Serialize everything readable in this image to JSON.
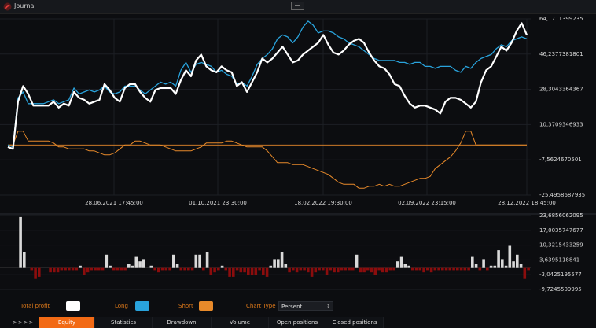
{
  "window": {
    "title": "Journal"
  },
  "colors": {
    "total_profit": "#ffffff",
    "long": "#29a3dc",
    "short": "#e88a2a",
    "bar_positive": "#d9d9d9",
    "bar_negative": "#8b0d0d",
    "accent": "#f26a15"
  },
  "upper_chart": {
    "y_ticks": [
      "64,1711399235",
      "46,2377381801",
      "28,3043364367",
      "10,3709346933",
      "-7,5624670501",
      "-25,4958687935"
    ],
    "x_ticks": [
      "28.06.2021 17:45:00",
      "01.10.2021 23:30:00",
      "18.02.2022 19:30:00",
      "02.09.2022 23:15:00",
      "28.12.2022 18:45:00"
    ],
    "ylim": [
      -25.4958687935,
      64.1711399235
    ],
    "total": [
      -1,
      -2,
      22,
      30,
      26,
      20,
      20,
      20,
      20,
      22,
      19,
      21,
      20,
      27,
      24,
      23,
      21,
      22,
      23,
      31,
      28,
      24,
      22,
      29,
      31,
      31,
      27,
      24,
      22,
      28,
      29,
      29,
      29,
      26,
      33,
      38,
      35,
      43,
      46,
      40,
      38,
      37,
      40,
      38,
      37,
      30,
      32,
      27,
      32,
      37,
      44,
      42,
      44,
      47,
      50,
      46,
      42,
      43,
      46,
      48,
      50,
      52,
      56,
      51,
      47,
      46,
      48,
      51,
      53,
      54,
      52,
      47,
      43,
      40,
      39,
      36,
      31,
      30,
      25,
      21,
      19,
      20,
      20,
      19,
      18,
      16,
      22,
      24,
      24,
      23,
      21,
      19,
      22,
      32,
      38,
      40,
      45,
      50,
      48,
      52,
      58,
      62,
      56
    ],
    "long": [
      0,
      -1,
      24,
      27,
      21,
      21,
      21,
      21,
      22,
      23,
      21,
      22,
      23,
      29,
      26,
      27,
      28,
      27,
      28,
      30,
      27,
      26,
      27,
      30,
      30,
      30,
      28,
      26,
      28,
      30,
      32,
      31,
      32,
      30,
      38,
      42,
      37,
      41,
      42,
      41,
      40,
      37,
      38,
      36,
      35,
      31,
      32,
      30,
      35,
      41,
      44,
      46,
      49,
      54,
      56,
      55,
      52,
      55,
      60,
      63,
      61,
      57,
      58,
      58,
      57,
      55,
      54,
      52,
      51,
      50,
      48,
      46,
      44,
      43,
      43,
      43,
      43,
      42,
      42,
      41,
      42,
      42,
      40,
      40,
      39,
      40,
      40,
      40,
      38,
      37,
      40,
      39,
      42,
      44,
      45,
      46,
      49,
      51,
      50,
      53,
      54,
      55,
      54
    ],
    "short": [
      0,
      0,
      7,
      7,
      2,
      2,
      2,
      2,
      2,
      1,
      -1,
      -1,
      -2,
      -2,
      -2,
      -2,
      -3,
      -3,
      -4,
      -5,
      -5,
      -4,
      -2,
      0,
      0,
      2,
      2,
      1,
      0,
      0,
      0,
      -1,
      -2,
      -3,
      -3,
      -3,
      -3,
      -2,
      -1,
      1,
      1,
      1,
      1,
      2,
      2,
      1,
      0,
      -1,
      -1,
      -1,
      -1,
      -3,
      -6,
      -9,
      -9,
      -9,
      -10,
      -10,
      -10,
      -11,
      -12,
      -13,
      -14,
      -15,
      -17,
      -19,
      -20,
      -20,
      -20,
      -22,
      -22,
      -21,
      -21,
      -20,
      -21,
      -20,
      -21,
      -21,
      -20,
      -19,
      -18,
      -17,
      -17,
      -16,
      -12,
      -10,
      -8,
      -6,
      -3,
      1,
      7,
      7,
      0,
      0,
      0,
      0,
      0,
      0,
      0,
      0,
      0,
      0,
      0
    ],
    "baseline": 0
  },
  "lower_chart": {
    "y_ticks": [
      "23,6856062095",
      "17,0035747677",
      "10,3215433259",
      "3,6395118841",
      "-3,0425195577",
      "-9,7245509995"
    ],
    "ylim": [
      -9.7245509995,
      23.6856062095
    ],
    "bars": [
      0,
      0,
      0,
      23,
      7,
      0,
      -1,
      -5,
      -4,
      0,
      0,
      -2,
      -2,
      -2,
      -1,
      -1,
      -1,
      -1,
      -1,
      1,
      -3,
      -2,
      -1,
      -1,
      -1,
      -1,
      6,
      1,
      -1,
      -1,
      -1,
      -1,
      2,
      1,
      5,
      3,
      4,
      0,
      1,
      -1,
      -2,
      -1,
      -1,
      -1,
      6,
      2,
      -1,
      -1,
      -1,
      -1,
      6,
      6,
      -1,
      7,
      -3,
      -2,
      -1,
      1,
      -1,
      -4,
      -4,
      -1,
      -2,
      -2,
      -3,
      -3,
      -3,
      -1,
      -3,
      -4,
      1,
      4,
      4,
      7,
      2,
      -2,
      -1,
      -2,
      -1,
      -1,
      -2,
      -4,
      -2,
      -1,
      -1,
      -3,
      -1,
      -2,
      -2,
      -1,
      -1,
      -1,
      -1,
      6,
      -2,
      -2,
      -1,
      -2,
      -3,
      -1,
      -2,
      -2,
      -1,
      -1,
      3,
      5,
      2,
      1,
      -1,
      -1,
      -1,
      -2,
      -1,
      -2,
      -1,
      -1,
      -1,
      -1,
      -1,
      -1,
      -1,
      -1,
      -1,
      -1,
      5,
      2,
      -1,
      4,
      -1,
      1,
      1,
      8,
      4,
      1,
      10,
      3,
      6,
      2,
      -5,
      -1
    ]
  },
  "legend": {
    "total_profit_label": "Total profit",
    "long_label": "Long",
    "short_label": "Short",
    "chart_type_label": "Chart Type",
    "chart_type_value": "Persent"
  },
  "tabs": {
    "prefix": ">>>>",
    "items": [
      "Equity",
      "Statistics",
      "Drawdown",
      "Volume",
      "Open positions",
      "Closed positions"
    ],
    "active": 0
  }
}
